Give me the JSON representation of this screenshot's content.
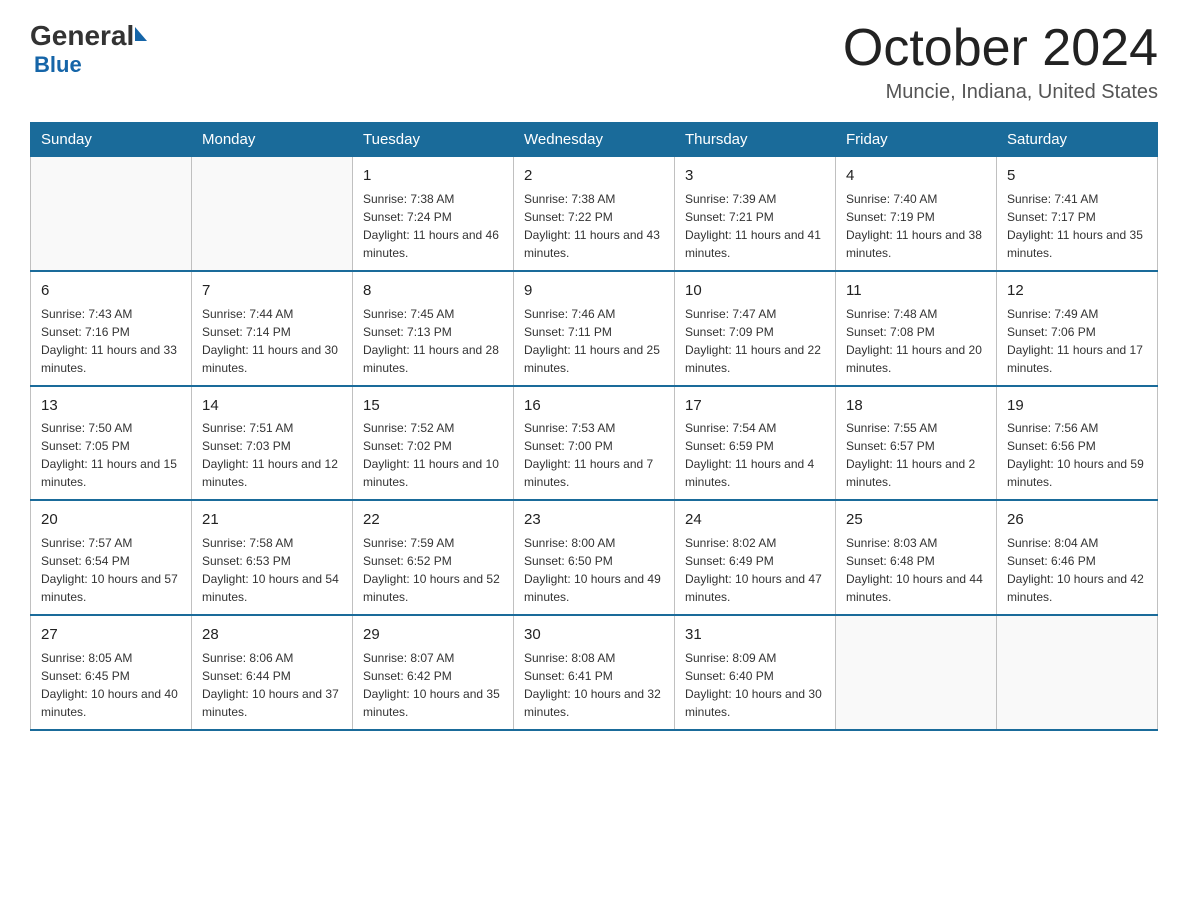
{
  "header": {
    "logo_general": "General",
    "logo_blue": "Blue",
    "month_title": "October 2024",
    "location": "Muncie, Indiana, United States"
  },
  "days_of_week": [
    "Sunday",
    "Monday",
    "Tuesday",
    "Wednesday",
    "Thursday",
    "Friday",
    "Saturday"
  ],
  "weeks": [
    [
      {
        "day": "",
        "sunrise": "",
        "sunset": "",
        "daylight": ""
      },
      {
        "day": "",
        "sunrise": "",
        "sunset": "",
        "daylight": ""
      },
      {
        "day": "1",
        "sunrise": "Sunrise: 7:38 AM",
        "sunset": "Sunset: 7:24 PM",
        "daylight": "Daylight: 11 hours and 46 minutes."
      },
      {
        "day": "2",
        "sunrise": "Sunrise: 7:38 AM",
        "sunset": "Sunset: 7:22 PM",
        "daylight": "Daylight: 11 hours and 43 minutes."
      },
      {
        "day": "3",
        "sunrise": "Sunrise: 7:39 AM",
        "sunset": "Sunset: 7:21 PM",
        "daylight": "Daylight: 11 hours and 41 minutes."
      },
      {
        "day": "4",
        "sunrise": "Sunrise: 7:40 AM",
        "sunset": "Sunset: 7:19 PM",
        "daylight": "Daylight: 11 hours and 38 minutes."
      },
      {
        "day": "5",
        "sunrise": "Sunrise: 7:41 AM",
        "sunset": "Sunset: 7:17 PM",
        "daylight": "Daylight: 11 hours and 35 minutes."
      }
    ],
    [
      {
        "day": "6",
        "sunrise": "Sunrise: 7:43 AM",
        "sunset": "Sunset: 7:16 PM",
        "daylight": "Daylight: 11 hours and 33 minutes."
      },
      {
        "day": "7",
        "sunrise": "Sunrise: 7:44 AM",
        "sunset": "Sunset: 7:14 PM",
        "daylight": "Daylight: 11 hours and 30 minutes."
      },
      {
        "day": "8",
        "sunrise": "Sunrise: 7:45 AM",
        "sunset": "Sunset: 7:13 PM",
        "daylight": "Daylight: 11 hours and 28 minutes."
      },
      {
        "day": "9",
        "sunrise": "Sunrise: 7:46 AM",
        "sunset": "Sunset: 7:11 PM",
        "daylight": "Daylight: 11 hours and 25 minutes."
      },
      {
        "day": "10",
        "sunrise": "Sunrise: 7:47 AM",
        "sunset": "Sunset: 7:09 PM",
        "daylight": "Daylight: 11 hours and 22 minutes."
      },
      {
        "day": "11",
        "sunrise": "Sunrise: 7:48 AM",
        "sunset": "Sunset: 7:08 PM",
        "daylight": "Daylight: 11 hours and 20 minutes."
      },
      {
        "day": "12",
        "sunrise": "Sunrise: 7:49 AM",
        "sunset": "Sunset: 7:06 PM",
        "daylight": "Daylight: 11 hours and 17 minutes."
      }
    ],
    [
      {
        "day": "13",
        "sunrise": "Sunrise: 7:50 AM",
        "sunset": "Sunset: 7:05 PM",
        "daylight": "Daylight: 11 hours and 15 minutes."
      },
      {
        "day": "14",
        "sunrise": "Sunrise: 7:51 AM",
        "sunset": "Sunset: 7:03 PM",
        "daylight": "Daylight: 11 hours and 12 minutes."
      },
      {
        "day": "15",
        "sunrise": "Sunrise: 7:52 AM",
        "sunset": "Sunset: 7:02 PM",
        "daylight": "Daylight: 11 hours and 10 minutes."
      },
      {
        "day": "16",
        "sunrise": "Sunrise: 7:53 AM",
        "sunset": "Sunset: 7:00 PM",
        "daylight": "Daylight: 11 hours and 7 minutes."
      },
      {
        "day": "17",
        "sunrise": "Sunrise: 7:54 AM",
        "sunset": "Sunset: 6:59 PM",
        "daylight": "Daylight: 11 hours and 4 minutes."
      },
      {
        "day": "18",
        "sunrise": "Sunrise: 7:55 AM",
        "sunset": "Sunset: 6:57 PM",
        "daylight": "Daylight: 11 hours and 2 minutes."
      },
      {
        "day": "19",
        "sunrise": "Sunrise: 7:56 AM",
        "sunset": "Sunset: 6:56 PM",
        "daylight": "Daylight: 10 hours and 59 minutes."
      }
    ],
    [
      {
        "day": "20",
        "sunrise": "Sunrise: 7:57 AM",
        "sunset": "Sunset: 6:54 PM",
        "daylight": "Daylight: 10 hours and 57 minutes."
      },
      {
        "day": "21",
        "sunrise": "Sunrise: 7:58 AM",
        "sunset": "Sunset: 6:53 PM",
        "daylight": "Daylight: 10 hours and 54 minutes."
      },
      {
        "day": "22",
        "sunrise": "Sunrise: 7:59 AM",
        "sunset": "Sunset: 6:52 PM",
        "daylight": "Daylight: 10 hours and 52 minutes."
      },
      {
        "day": "23",
        "sunrise": "Sunrise: 8:00 AM",
        "sunset": "Sunset: 6:50 PM",
        "daylight": "Daylight: 10 hours and 49 minutes."
      },
      {
        "day": "24",
        "sunrise": "Sunrise: 8:02 AM",
        "sunset": "Sunset: 6:49 PM",
        "daylight": "Daylight: 10 hours and 47 minutes."
      },
      {
        "day": "25",
        "sunrise": "Sunrise: 8:03 AM",
        "sunset": "Sunset: 6:48 PM",
        "daylight": "Daylight: 10 hours and 44 minutes."
      },
      {
        "day": "26",
        "sunrise": "Sunrise: 8:04 AM",
        "sunset": "Sunset: 6:46 PM",
        "daylight": "Daylight: 10 hours and 42 minutes."
      }
    ],
    [
      {
        "day": "27",
        "sunrise": "Sunrise: 8:05 AM",
        "sunset": "Sunset: 6:45 PM",
        "daylight": "Daylight: 10 hours and 40 minutes."
      },
      {
        "day": "28",
        "sunrise": "Sunrise: 8:06 AM",
        "sunset": "Sunset: 6:44 PM",
        "daylight": "Daylight: 10 hours and 37 minutes."
      },
      {
        "day": "29",
        "sunrise": "Sunrise: 8:07 AM",
        "sunset": "Sunset: 6:42 PM",
        "daylight": "Daylight: 10 hours and 35 minutes."
      },
      {
        "day": "30",
        "sunrise": "Sunrise: 8:08 AM",
        "sunset": "Sunset: 6:41 PM",
        "daylight": "Daylight: 10 hours and 32 minutes."
      },
      {
        "day": "31",
        "sunrise": "Sunrise: 8:09 AM",
        "sunset": "Sunset: 6:40 PM",
        "daylight": "Daylight: 10 hours and 30 minutes."
      },
      {
        "day": "",
        "sunrise": "",
        "sunset": "",
        "daylight": ""
      },
      {
        "day": "",
        "sunrise": "",
        "sunset": "",
        "daylight": ""
      }
    ]
  ]
}
